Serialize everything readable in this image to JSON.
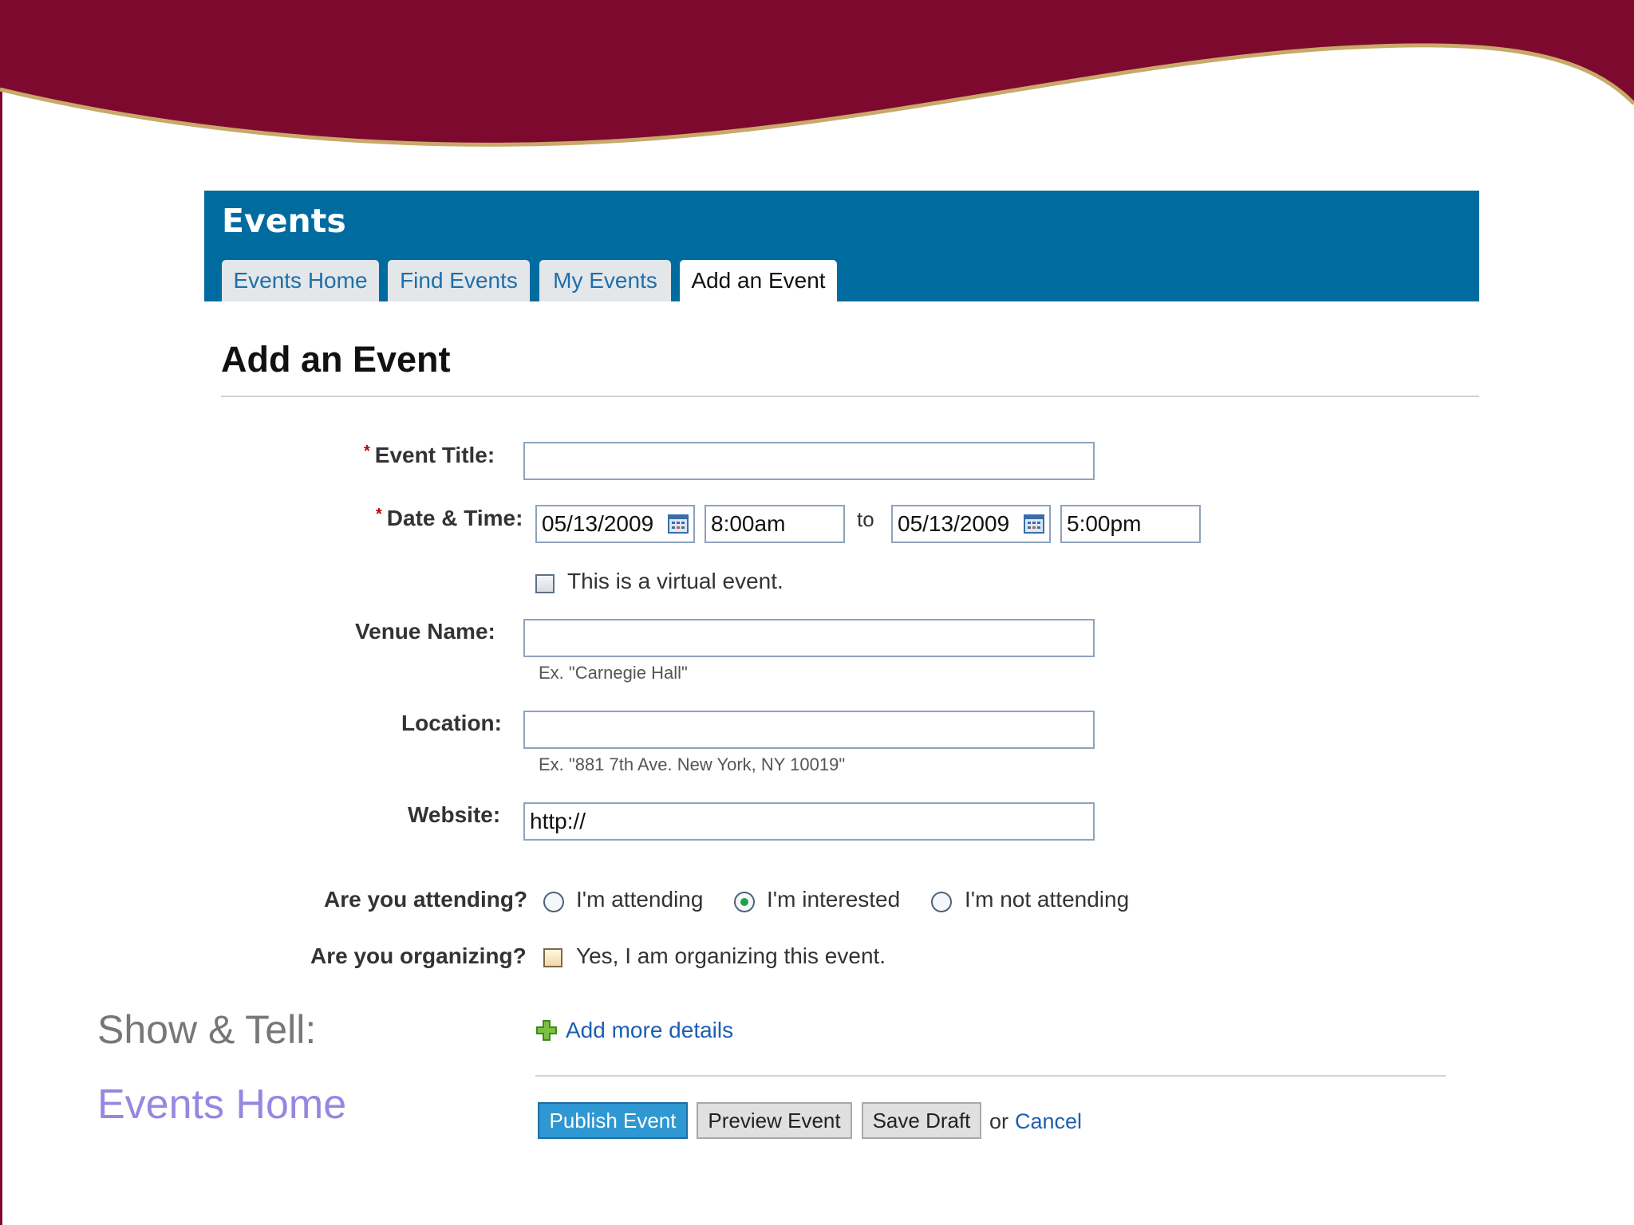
{
  "header": {
    "title": "Events",
    "tabs": [
      {
        "label": "Events Home",
        "active": false
      },
      {
        "label": "Find Events",
        "active": false
      },
      {
        "label": "My Events",
        "active": false
      },
      {
        "label": "Add an Event",
        "active": true
      }
    ]
  },
  "page": {
    "title": "Add an Event"
  },
  "form": {
    "required_marker": "*",
    "event_title": {
      "label": "Event Title:",
      "value": ""
    },
    "date_time": {
      "label": "Date & Time:",
      "start_date": "05/13/2009",
      "start_time": "8:00am",
      "to_label": "to",
      "end_date": "05/13/2009",
      "end_time": "5:00pm"
    },
    "virtual_event": {
      "label": "This is a virtual event.",
      "checked": false
    },
    "venue": {
      "label": "Venue Name:",
      "value": "",
      "hint": "Ex. \"Carnegie Hall\""
    },
    "location": {
      "label": "Location:",
      "value": "",
      "hint": "Ex. \"881 7th Ave. New York, NY 10019\""
    },
    "website": {
      "label": "Website:",
      "value": "http://"
    },
    "attending": {
      "label": "Are you attending?",
      "options": [
        "I'm attending",
        "I'm interested",
        "I'm not attending"
      ],
      "selected": "I'm interested"
    },
    "organizing": {
      "label": "Are you organizing?",
      "option": "Yes, I am organizing this event.",
      "checked": false
    },
    "add_more": "Add more details"
  },
  "actions": {
    "publish": "Publish Event",
    "preview": "Preview Event",
    "save_draft": "Save Draft",
    "or": "or",
    "cancel": "Cancel"
  },
  "slide": {
    "show_tell": "Show & Tell:",
    "events_home": "Events Home"
  },
  "colors": {
    "banner_maroon": "#7d0a2e",
    "banner_gold": "#c8a96a",
    "header_blue": "#006b9f",
    "link_blue": "#1c5fb3",
    "button_blue": "#2f97d2",
    "slide_link_purple": "#9687e0"
  }
}
